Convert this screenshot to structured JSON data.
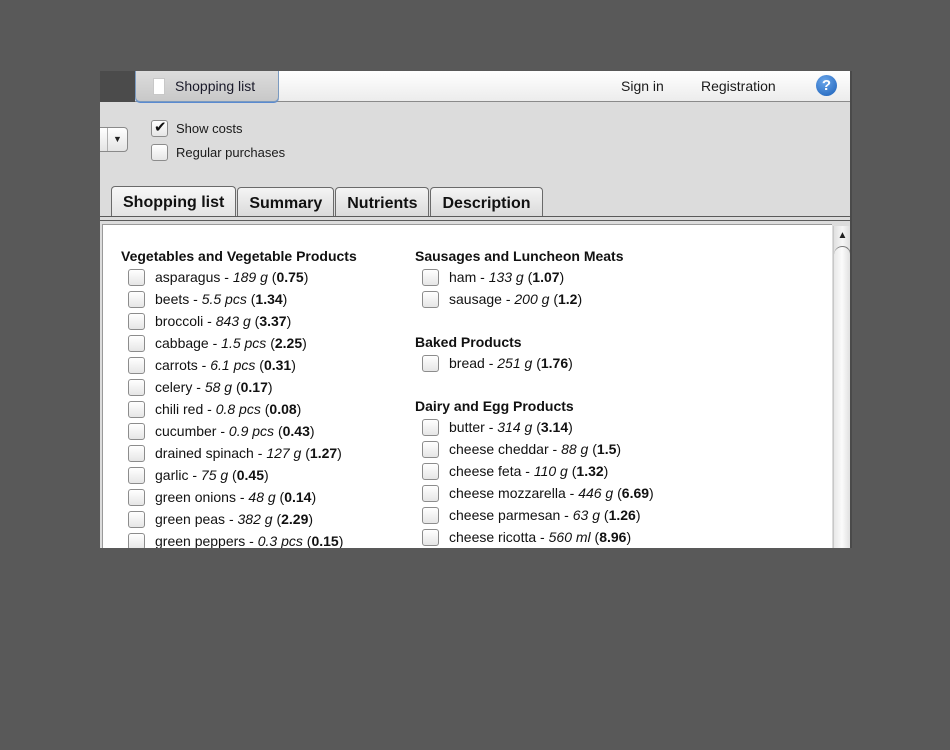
{
  "topbar": {
    "active_tab": "Shopping list",
    "sign_in": "Sign in",
    "registration": "Registration",
    "help_icon": "?"
  },
  "options": {
    "dropdown_icon": "▼",
    "show_costs": {
      "label": "Show costs",
      "checked": true
    },
    "regular_purchases": {
      "label": "Regular purchases",
      "checked": false
    }
  },
  "tabs": [
    {
      "label": "Shopping list",
      "active": true
    },
    {
      "label": "Summary",
      "active": false
    },
    {
      "label": "Nutrients",
      "active": false
    },
    {
      "label": "Description",
      "active": false
    }
  ],
  "scrollbar": {
    "up_icon": "▲"
  },
  "columns": [
    {
      "categories": [
        {
          "title": "Vegetables and Vegetable Products",
          "items": [
            {
              "name": "asparagus",
              "qty": "189 g",
              "cost": "0.75"
            },
            {
              "name": "beets",
              "qty": "5.5 pcs",
              "cost": "1.34"
            },
            {
              "name": "broccoli",
              "qty": "843 g",
              "cost": "3.37"
            },
            {
              "name": "cabbage",
              "qty": "1.5 pcs",
              "cost": "2.25"
            },
            {
              "name": "carrots",
              "qty": "6.1 pcs",
              "cost": "0.31"
            },
            {
              "name": "celery",
              "qty": "58 g",
              "cost": "0.17"
            },
            {
              "name": "chili red",
              "qty": "0.8 pcs",
              "cost": "0.08"
            },
            {
              "name": "cucumber",
              "qty": "0.9 pcs",
              "cost": "0.43"
            },
            {
              "name": "drained spinach",
              "qty": "127 g",
              "cost": "1.27"
            },
            {
              "name": "garlic",
              "qty": "75 g",
              "cost": "0.45"
            },
            {
              "name": "green onions",
              "qty": "48 g",
              "cost": "0.14"
            },
            {
              "name": "green peas",
              "qty": "382 g",
              "cost": "2.29"
            },
            {
              "name": "green peppers",
              "qty": "0.3 pcs",
              "cost": "0.15"
            }
          ]
        }
      ]
    },
    {
      "categories": [
        {
          "title": "Sausages and Luncheon Meats",
          "items": [
            {
              "name": "ham",
              "qty": "133 g",
              "cost": "1.07"
            },
            {
              "name": "sausage",
              "qty": "200 g",
              "cost": "1.2"
            }
          ]
        },
        {
          "title": "Baked Products",
          "items": [
            {
              "name": "bread",
              "qty": "251 g",
              "cost": "1.76"
            }
          ]
        },
        {
          "title": "Dairy and Egg Products",
          "items": [
            {
              "name": "butter",
              "qty": "314 g",
              "cost": "3.14"
            },
            {
              "name": "cheese cheddar",
              "qty": "88 g",
              "cost": "1.5"
            },
            {
              "name": "cheese feta",
              "qty": "110 g",
              "cost": "1.32"
            },
            {
              "name": "cheese mozzarella",
              "qty": "446 g",
              "cost": "6.69"
            },
            {
              "name": "cheese parmesan",
              "qty": "63 g",
              "cost": "1.26"
            },
            {
              "name": "cheese ricotta",
              "qty": "560 ml",
              "cost": "8.96"
            }
          ]
        }
      ]
    }
  ]
}
